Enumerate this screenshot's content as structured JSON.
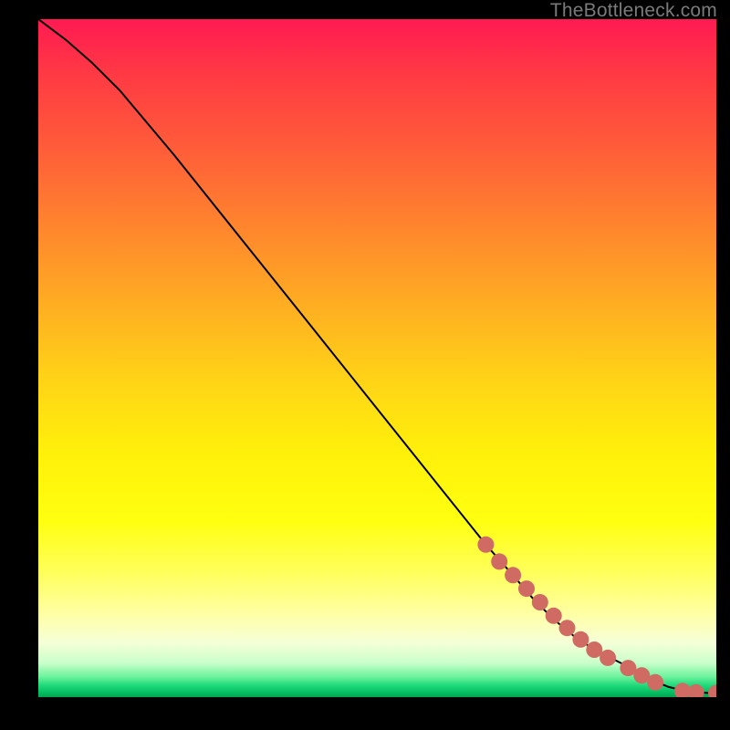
{
  "watermark": "TheBottleneck.com",
  "colors": {
    "marker": "#cf6b63",
    "curve": "#000000",
    "frame": "#000000"
  },
  "chart_data": {
    "type": "line",
    "title": "",
    "xlabel": "",
    "ylabel": "",
    "xlim": [
      0,
      100
    ],
    "ylim": [
      0,
      100
    ],
    "axis_ticks_hidden": true,
    "series": [
      {
        "name": "bottleneck-curve",
        "x": [
          0,
          4,
          8,
          12,
          20,
          30,
          40,
          50,
          60,
          66,
          70,
          73,
          76,
          79,
          82,
          85,
          87,
          89,
          91,
          93,
          95,
          97,
          99,
          100
        ],
        "y": [
          100,
          97,
          93.5,
          89.5,
          80,
          67.5,
          55,
          42.5,
          30,
          22.5,
          18,
          14.5,
          11.5,
          9,
          7,
          5.5,
          4.5,
          3.3,
          2.3,
          1.5,
          1.0,
          0.7,
          0.6,
          0.6
        ]
      }
    ],
    "markers": {
      "name": "highlighted-points",
      "x": [
        66,
        68,
        70,
        72,
        74,
        76,
        78,
        80,
        82,
        84,
        87,
        89,
        91,
        95,
        97,
        100
      ],
      "y": [
        22.5,
        20,
        18,
        16,
        14,
        12,
        10.2,
        8.5,
        7,
        5.8,
        4.3,
        3.2,
        2.2,
        0.9,
        0.7,
        0.6
      ]
    }
  }
}
